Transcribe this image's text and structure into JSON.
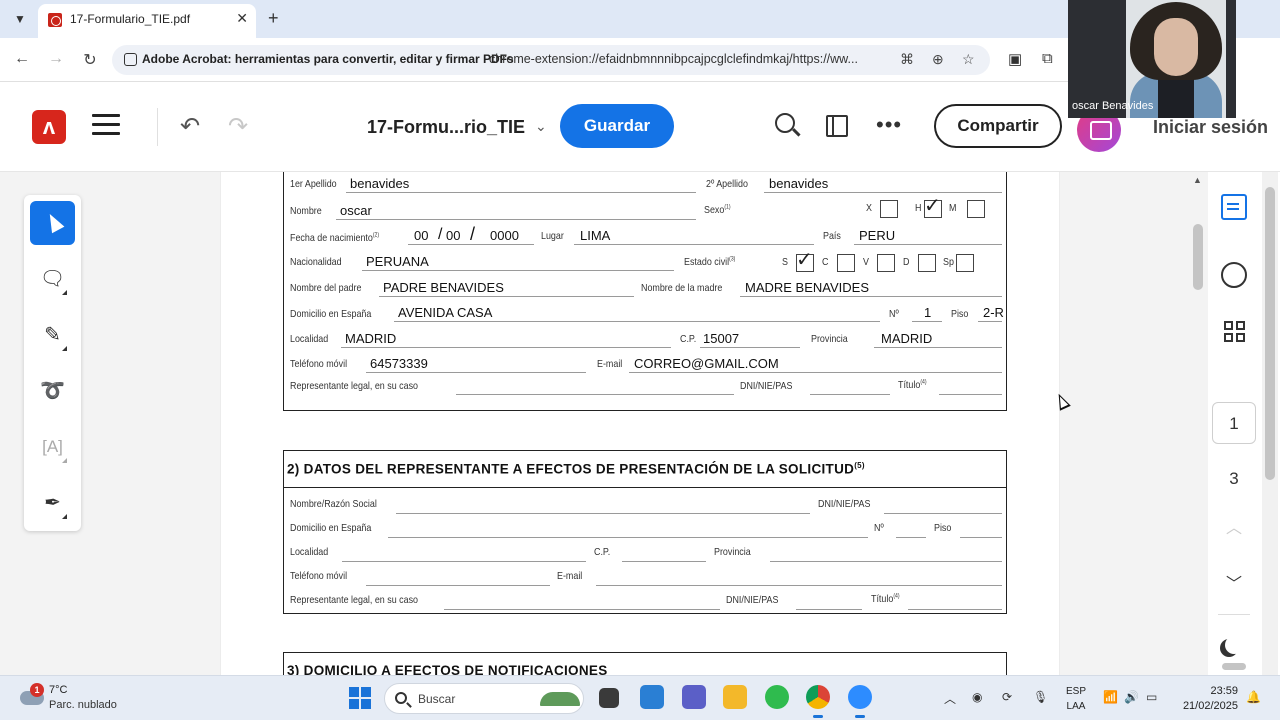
{
  "browser": {
    "tab_title": "17-Formulario_TIE.pdf",
    "extension_label": "Adobe Acrobat: herramientas para convertir, editar y firmar PDFs",
    "url": "chrome-extension://efaidnbmnnnibpcajpcglclefindmkaj/https://ww..."
  },
  "acrobat": {
    "doc_title": "17-Formu...rio_TIE",
    "save_label": "Guardar",
    "share_label": "Compartir",
    "signin_label": "Iniciar sesión"
  },
  "webcam": {
    "name": "oscar Benavides"
  },
  "section1": {
    "apellido1_label": "1er Apellido",
    "apellido1_value": "benavides",
    "apellido2_label": "2º Apellido",
    "apellido2_value": "benavides",
    "nombre_label": "Nombre",
    "nombre_value": "oscar",
    "sexo_label": "Sexo",
    "sexo_sup": "(1)",
    "sexo_x": "X",
    "sexo_h": "H",
    "sexo_m": "M",
    "fecha_label": "Fecha de nacimiento",
    "fecha_sup": "(2)",
    "fecha_dd": "00",
    "fecha_mm": "00",
    "fecha_yyyy": "0000",
    "lugar_label": "Lugar",
    "lugar_value": "LIMA",
    "pais_label": "País",
    "pais_value": "PERU",
    "nacionalidad_label": "Nacionalidad",
    "nacionalidad_value": "PERUANA",
    "estado_label": "Estado civil",
    "estado_sup": "(3)",
    "estado_s": "S",
    "estado_c": "C",
    "estado_v": "V",
    "estado_d": "D",
    "estado_sp": "Sp",
    "padre_label": "Nombre del padre",
    "padre_value": "PADRE BENAVIDES",
    "madre_label": "Nombre de la madre",
    "madre_value": "MADRE BENAVIDES",
    "domicilio_label": "Domicilio en España",
    "domicilio_value": "AVENIDA CASA",
    "num_label": "Nº",
    "num_value": "1",
    "piso_label": "Piso",
    "piso_value": "2-R",
    "localidad_label": "Localidad",
    "localidad_value": "MADRID",
    "cp_label": "C.P.",
    "cp_value": "15007",
    "provincia_label": "Provincia",
    "provincia_value": "MADRID",
    "telefono_label": "Teléfono móvil",
    "telefono_value": "64573339",
    "email_label": "E-mail",
    "email_value": "CORREO@GMAIL.COM",
    "representante_label": "Representante legal, en su caso",
    "dni_label": "DNI/NIE/PAS",
    "titulo_label": "Título",
    "titulo_sup": "(4)"
  },
  "section2": {
    "title": "2)  DATOS DEL REPRESENTANTE A EFECTOS DE PRESENTACIÓN DE LA SOLICITUD",
    "title_sup": "(5)",
    "nombre_label": "Nombre/Razón Social",
    "dni_label": "DNI/NIE/PAS",
    "domicilio_label": "Domicilio en España",
    "num_label": "Nº",
    "piso_label": "Piso",
    "localidad_label": "Localidad",
    "cp_label": "C.P.",
    "provincia_label": "Provincia",
    "telefono_label": "Teléfono móvil",
    "email_label": "E-mail",
    "representante_label": "Representante legal, en su caso",
    "dni2_label": "DNI/NIE/PAS",
    "titulo_label": "Título",
    "titulo_sup": "(4)"
  },
  "section3": {
    "title": "3)  DOMICILIO A EFECTOS DE NOTIFICACIONES"
  },
  "sidebar": {
    "page_current": "1",
    "page_total": "3"
  },
  "taskbar": {
    "temperature": "7°C",
    "weather": "Parc. nublado",
    "weather_badge": "1",
    "search_label": "Buscar",
    "lang_line1": "ESP",
    "lang_line2": "LAA",
    "time": "23:59",
    "date": "21/02/2025"
  },
  "colors": {
    "accent": "#1473e6",
    "acrobat_red": "#d7261c"
  }
}
